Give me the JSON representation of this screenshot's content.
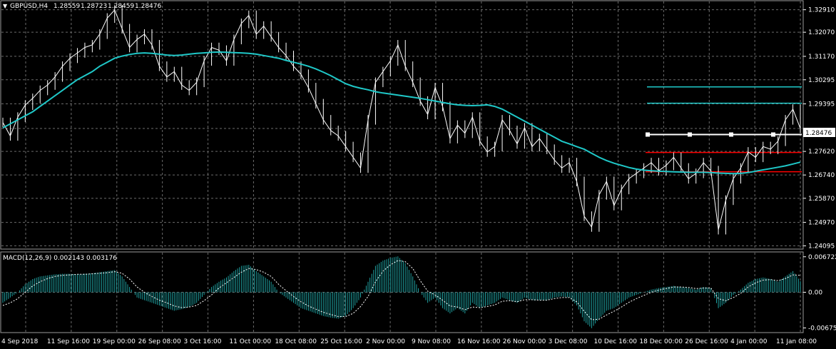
{
  "header": {
    "symbol": "GBPUSD,H4",
    "open": "1.28559",
    "high": "1.28723",
    "low": "1.28459",
    "close": "1.28476"
  },
  "colors": {
    "background": "#000000",
    "grid": "#6b6b6b",
    "price": "#ffffff",
    "moving_average": "#1fc8c8",
    "level": "#1fc8c8",
    "support": "#ff0000",
    "histogram": "#1fa0a0",
    "signal": "#ffffff"
  },
  "chart_data": [
    {
      "type": "line",
      "title": "GBPUSD,H4",
      "y_ticks": [
        "1.32910",
        "1.32070",
        "1.31170",
        "1.30295",
        "1.29395",
        "1.28476",
        "1.27620",
        "1.26740",
        "1.25870",
        "1.24970",
        "1.24095"
      ],
      "ylim": [
        1.24,
        1.3322
      ],
      "current_price": "1.28476",
      "x_ticks": [
        "4 Sep 2018",
        "11 Sep 16:00",
        "19 Sep 00:00",
        "26 Sep 08:00",
        "3 Oct 16:00",
        "11 Oct 00:00",
        "18 Oct 08:00",
        "25 Oct 16:00",
        "2 Nov 00:00",
        "9 Nov 08:00",
        "16 Nov 16:00",
        "26 Nov 00:00",
        "3 Dec 08:00",
        "10 Dec 16:00",
        "18 Dec 00:00",
        "26 Dec 16:00",
        "4 Jan 00:00",
        "11 Jan 08:00"
      ],
      "series": [
        {
          "kind": "price",
          "values": [
            1.287,
            1.282,
            1.289,
            1.2935,
            1.296,
            1.299,
            1.301,
            1.304,
            1.308,
            1.311,
            1.313,
            1.315,
            1.316,
            1.32,
            1.326,
            1.329,
            1.322,
            1.315,
            1.318,
            1.32,
            1.316,
            1.308,
            1.304,
            1.306,
            1.301,
            1.299,
            1.302,
            1.31,
            1.315,
            1.314,
            1.31,
            1.318,
            1.324,
            1.327,
            1.32,
            1.323,
            1.319,
            1.315,
            1.312,
            1.308,
            1.305,
            1.3,
            1.294,
            1.288,
            1.284,
            1.282,
            1.278,
            1.274,
            1.27,
            1.288,
            1.302,
            1.306,
            1.31,
            1.316,
            1.308,
            1.302,
            1.295,
            1.29,
            1.3,
            1.293,
            1.281,
            1.286,
            1.283,
            1.289,
            1.28,
            1.276,
            1.278,
            1.288,
            1.284,
            1.279,
            1.285,
            1.278,
            1.281,
            1.277,
            1.273,
            1.27,
            1.272,
            1.265,
            1.252,
            1.248,
            1.26,
            1.265,
            1.256,
            1.262,
            1.266,
            1.268,
            1.27,
            1.272,
            1.269,
            1.271,
            1.274,
            1.27,
            1.266,
            1.268,
            1.272,
            1.269,
            1.247,
            1.258,
            1.266,
            1.27,
            1.276,
            1.274,
            1.278,
            1.277,
            1.28,
            1.288,
            1.292,
            1.2848
          ]
        },
        {
          "kind": "moving_average",
          "values": [
            1.285,
            1.2865,
            1.288,
            1.2895,
            1.291,
            1.293,
            1.295,
            1.297,
            1.299,
            1.301,
            1.303,
            1.3045,
            1.306,
            1.308,
            1.3095,
            1.311,
            1.3118,
            1.3124,
            1.3128,
            1.313,
            1.3128,
            1.3125,
            1.3122,
            1.312,
            1.3122,
            1.3125,
            1.3128,
            1.313,
            1.3132,
            1.3133,
            1.3132,
            1.3131,
            1.313,
            1.3128,
            1.3125,
            1.312,
            1.3115,
            1.311,
            1.3102,
            1.3095,
            1.3088,
            1.308,
            1.307,
            1.3058,
            1.3045,
            1.303,
            1.3015,
            1.3005,
            1.2998,
            1.2992,
            1.2985,
            1.298,
            1.2976,
            1.2972,
            1.2968,
            1.2964,
            1.296,
            1.2955,
            1.295,
            1.2945,
            1.294,
            1.2936,
            1.2934,
            1.2933,
            1.2934,
            1.2936,
            1.293,
            1.292,
            1.2905,
            1.289,
            1.2875,
            1.286,
            1.2845,
            1.283,
            1.2815,
            1.28,
            1.279,
            1.278,
            1.277,
            1.2755,
            1.274,
            1.2728,
            1.2718,
            1.271,
            1.2702,
            1.2696,
            1.2692,
            1.269,
            1.2688,
            1.2687,
            1.2686,
            1.2685,
            1.2684,
            1.2684,
            1.2684,
            1.2683,
            1.2681,
            1.268,
            1.2679,
            1.268,
            1.2683,
            1.2688,
            1.2693,
            1.2698,
            1.2703,
            1.2708,
            1.2715,
            1.2722
          ]
        }
      ],
      "horizontal_levels": [
        {
          "value": 1.3003,
          "color": "cyan"
        },
        {
          "value": 1.2942,
          "color": "cyan"
        },
        {
          "value": 1.2825,
          "color": "white"
        },
        {
          "value": 1.2758,
          "color": "red"
        },
        {
          "value": 1.2686,
          "color": "red"
        }
      ]
    },
    {
      "type": "bar",
      "title": "MACD(12,26,9) 0.002143 0.003176",
      "y_ticks": [
        "0.006722",
        "0.00",
        "-0.006754"
      ],
      "ylim": [
        -0.0075,
        0.0075
      ],
      "series": [
        {
          "kind": "histogram",
          "values": [
            -0.002,
            -0.001,
            0.0,
            0.0015,
            0.0025,
            0.003,
            0.0032,
            0.0034,
            0.0035,
            0.0035,
            0.0034,
            0.0035,
            0.0036,
            0.0038,
            0.004,
            0.0042,
            0.003,
            0.001,
            -0.001,
            -0.0015,
            -0.002,
            -0.0025,
            -0.003,
            -0.0035,
            -0.0032,
            -0.0028,
            -0.002,
            -0.0005,
            0.001,
            0.002,
            0.0028,
            0.004,
            0.005,
            0.0052,
            0.004,
            0.003,
            0.002,
            0.0,
            -0.001,
            -0.002,
            -0.003,
            -0.0035,
            -0.004,
            -0.0045,
            -0.0048,
            -0.005,
            -0.0045,
            -0.003,
            -0.001,
            0.002,
            0.005,
            0.006,
            0.0065,
            0.0068,
            0.0055,
            0.003,
            0.0,
            -0.002,
            -0.001,
            -0.003,
            -0.004,
            -0.003,
            -0.004,
            -0.002,
            -0.003,
            -0.0025,
            -0.002,
            -0.001,
            -0.0015,
            -0.002,
            -0.001,
            -0.0015,
            -0.0015,
            -0.0015,
            -0.001,
            -0.0008,
            -0.001,
            -0.0025,
            -0.0055,
            -0.0068,
            -0.005,
            -0.0035,
            -0.003,
            -0.002,
            -0.001,
            -0.0005,
            0.0,
            0.0005,
            0.0008,
            0.001,
            0.0012,
            0.001,
            0.0008,
            0.0005,
            0.001,
            0.0008,
            -0.003,
            -0.002,
            -0.0005,
            0.0005,
            0.0018,
            0.0025,
            0.0028,
            0.0025,
            0.002,
            0.003,
            0.004,
            0.0021
          ]
        },
        {
          "kind": "signal",
          "values": [
            -0.0025,
            -0.002,
            -0.0012,
            0.0,
            0.0012,
            0.002,
            0.0026,
            0.003,
            0.0032,
            0.0033,
            0.0034,
            0.0034,
            0.0035,
            0.0036,
            0.0037,
            0.0039,
            0.0036,
            0.0025,
            0.001,
            0.0,
            -0.0008,
            -0.0015,
            -0.002,
            -0.0026,
            -0.0029,
            -0.0028,
            -0.0025,
            -0.0016,
            -0.0005,
            0.0008,
            0.0018,
            0.0028,
            0.0038,
            0.0045,
            0.0043,
            0.0038,
            0.003,
            0.0015,
            0.0003,
            -0.0008,
            -0.0018,
            -0.0026,
            -0.0032,
            -0.0038,
            -0.0042,
            -0.0046,
            -0.0046,
            -0.004,
            -0.0027,
            -0.0008,
            0.002,
            0.004,
            0.0052,
            0.006,
            0.0058,
            0.0045,
            0.0022,
            0.0002,
            -0.0005,
            -0.0015,
            -0.0026,
            -0.0028,
            -0.0033,
            -0.0028,
            -0.0029,
            -0.0027,
            -0.0024,
            -0.0017,
            -0.0016,
            -0.0018,
            -0.0014,
            -0.0014,
            -0.0015,
            -0.0015,
            -0.0012,
            -0.001,
            -0.001,
            -0.0018,
            -0.0036,
            -0.0052,
            -0.0051,
            -0.0043,
            -0.0036,
            -0.0028,
            -0.0019,
            -0.0012,
            -0.0006,
            0.0,
            0.0004,
            0.0007,
            0.001,
            0.001,
            0.0009,
            0.0007,
            0.0008,
            0.0008,
            -0.0012,
            -0.0016,
            -0.001,
            -0.0002,
            0.001,
            0.0018,
            0.0023,
            0.0024,
            0.0022,
            0.0026,
            0.0033,
            0.0032
          ]
        }
      ]
    }
  ]
}
